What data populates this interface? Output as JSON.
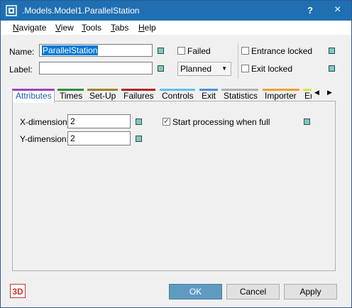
{
  "window": {
    "title": ".Models.Model1.ParallelStation",
    "help": "?",
    "close": "×"
  },
  "menu": [
    "Navigate",
    "View",
    "Tools",
    "Tabs",
    "Help"
  ],
  "form": {
    "name_label": "Name:",
    "name_value": "ParallelStation",
    "label_label": "Label:",
    "label_value": "",
    "failed_label": "Failed",
    "planned_value": "Planned",
    "entrance_label": "Entrance locked",
    "exit_label": "Exit locked"
  },
  "tabs": [
    {
      "label": "Attributes",
      "color": "#a040c0"
    },
    {
      "label": "Times",
      "color": "#2e8b3e"
    },
    {
      "label": "Set-Up",
      "color": "#a0822d"
    },
    {
      "label": "Failures",
      "color": "#b22222"
    },
    {
      "label": "Controls",
      "color": "#60c0e8"
    },
    {
      "label": "Exit",
      "color": "#4a90e2"
    },
    {
      "label": "Statistics",
      "color": "#b0b0b0"
    },
    {
      "label": "Importer",
      "color": "#f0a030"
    },
    {
      "label": "Er",
      "color": "#e0e040"
    }
  ],
  "attributes": {
    "x_label": "X-dimension:",
    "x_value": "2",
    "y_label": "Y-dimension:",
    "y_value": "2",
    "start_label": "Start processing when full",
    "start_checked": true
  },
  "footer": {
    "badge_3d": "3D",
    "ok": "OK",
    "cancel": "Cancel",
    "apply": "Apply"
  }
}
